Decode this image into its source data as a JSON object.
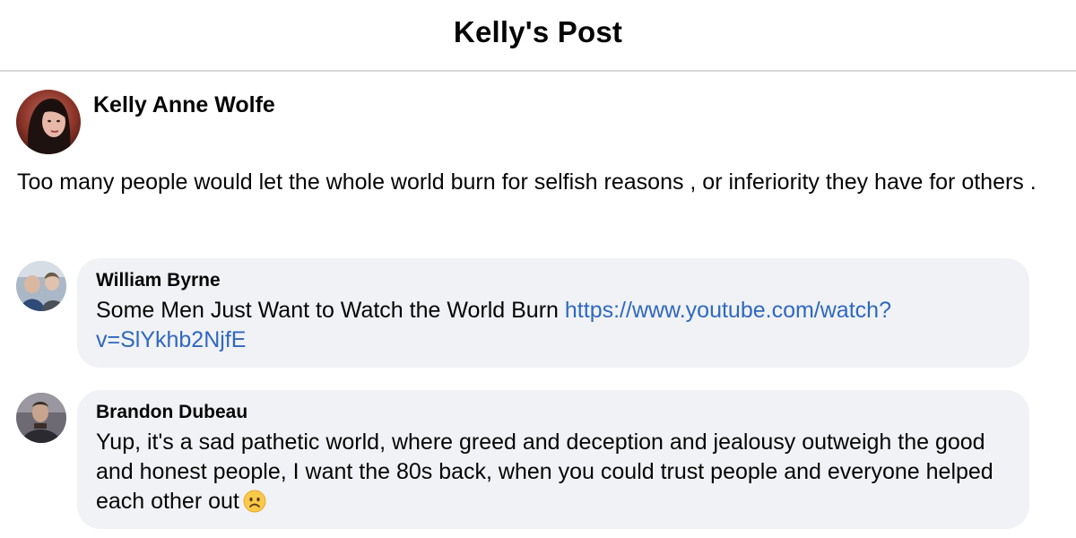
{
  "header": {
    "title": "Kelly's Post"
  },
  "post": {
    "author": "Kelly Anne Wolfe",
    "text": "Too many people would let the whole world burn for selfish reasons , or inferiority they have for others .",
    "avatar_icon": "profile-photo"
  },
  "comments": [
    {
      "author": "William Byrne",
      "text": "Some Men Just Want to Watch the World Burn",
      "link": "https://www.youtube.com/watch?v=SlYkhb2NjfE",
      "avatar_icon": "profile-photo"
    },
    {
      "author": "Brandon Dubeau",
      "text": "Yup, it's a sad pathetic world, where greed and deception and jealousy outweigh the good and honest people, I want the 80s back, when you could trust people and everyone helped each other out",
      "emoji_icon": "sad-face-emoji",
      "avatar_icon": "profile-photo"
    }
  ],
  "colors": {
    "bubble_bg": "#f0f2f5",
    "link": "#2f68c0",
    "divider": "#d8d8d8",
    "text": "#050505"
  }
}
